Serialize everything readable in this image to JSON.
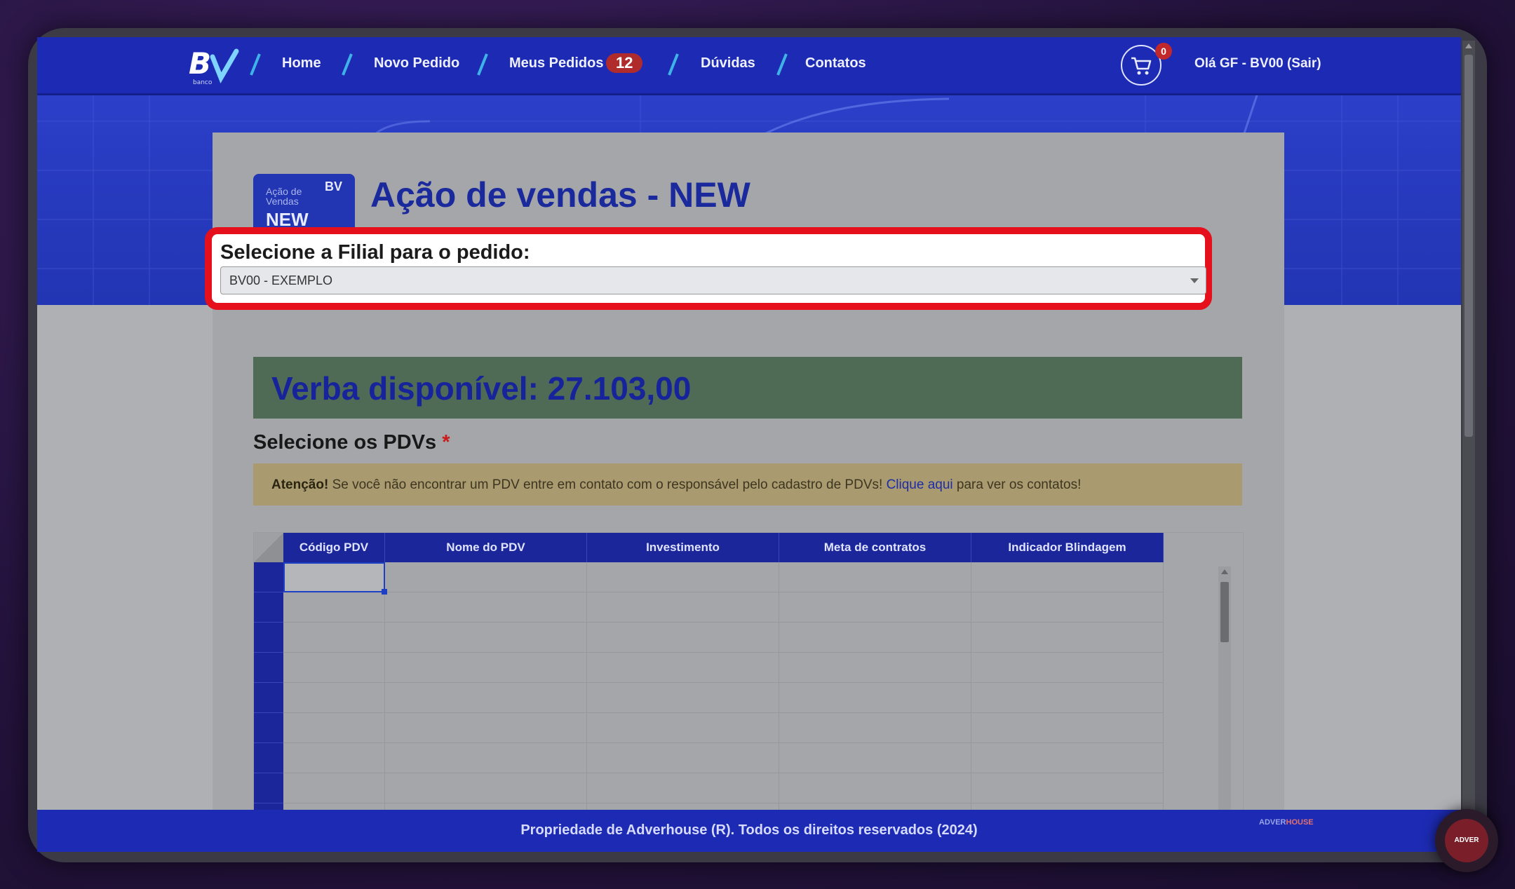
{
  "nav": {
    "logo_text": "BV",
    "logo_sub": "banco",
    "links": [
      {
        "label": "Home"
      },
      {
        "label": "Novo Pedido"
      },
      {
        "label": "Meus Pedidos"
      },
      {
        "label": "Dúvidas"
      },
      {
        "label": "Contatos"
      }
    ],
    "orders_badge": "12",
    "cart_count": "0",
    "greeting": "Olá GF - BV00 (Sair)"
  },
  "page": {
    "title": "Ação de vendas - NEW",
    "icon_small_text": "Ação de\nVendas",
    "icon_big_text": "NEW",
    "icon_logo": "BV"
  },
  "branch_select": {
    "label": "Selecione a Filial para o pedido:",
    "value": "BV00 - EXEMPLO"
  },
  "budget": {
    "text": "Verba disponível: 27.103,00"
  },
  "pdvs": {
    "heading": "Selecione os PDVs",
    "required_mark": "*",
    "alert_strong": "Atenção!",
    "alert_text": " Se você não encontrar um PDV entre em contato com o responsável pelo cadastro de PDVs! ",
    "alert_link": "Clique aqui",
    "alert_after": " para ver os contatos!"
  },
  "grid": {
    "columns": [
      "Código PDV",
      "Nome do PDV",
      "Investimento",
      "Meta de contratos",
      "Indicador Blindagem"
    ]
  },
  "footer": {
    "text": "Propriedade de Adverhouse (R). Todos os direitos reservados (2024)",
    "logo_a": "ADVER",
    "logo_b": "HOUSE"
  },
  "fab": {
    "label": "ADVER"
  },
  "colors": {
    "nav_bg": "#1d2bb4",
    "title_blue": "#1a2a9c",
    "highlight_red": "#e5101c",
    "badge_red": "#b02c2c"
  }
}
